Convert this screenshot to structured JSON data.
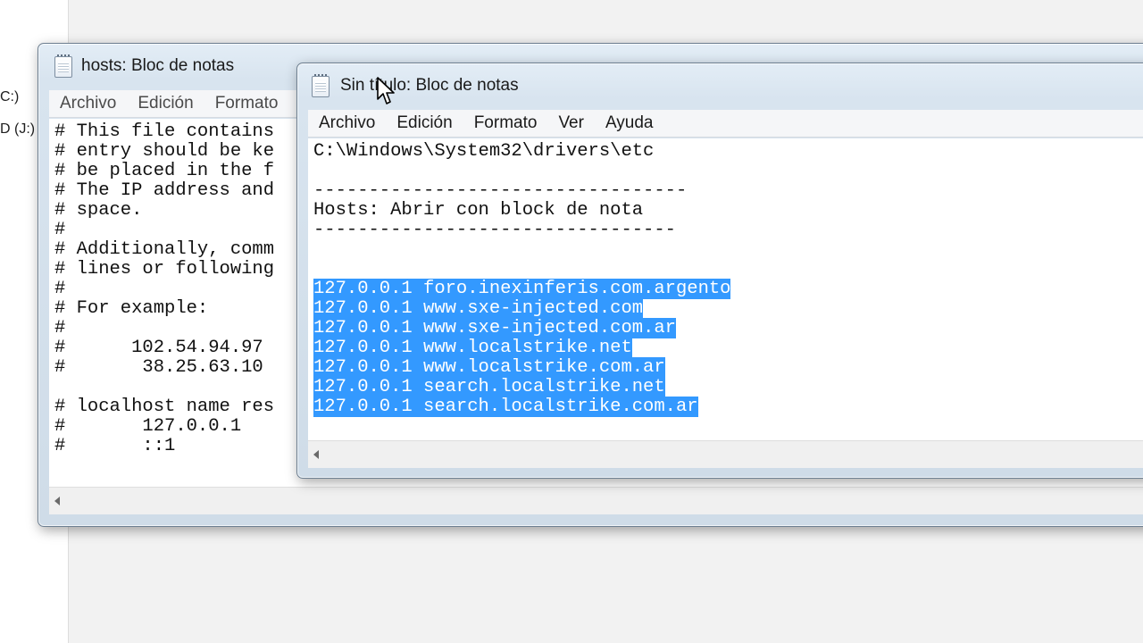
{
  "explorer": {
    "drive1": "C:)",
    "drive2": "D (J:)"
  },
  "back_window": {
    "title": "hosts: Bloc de notas",
    "menu": [
      "Archivo",
      "Edición",
      "Formato"
    ],
    "lines": [
      "# This file contains",
      "# entry should be ke",
      "# be placed in the f",
      "# The IP address and",
      "# space.",
      "#",
      "# Additionally, comm",
      "# lines or following",
      "#",
      "# For example:",
      "#",
      "#      102.54.94.97",
      "#       38.25.63.10",
      "",
      "# localhost name res",
      "#       127.0.0.1",
      "#       ::1"
    ]
  },
  "front_window": {
    "title": "Sin título: Bloc de notas",
    "menu": [
      "Archivo",
      "Edición",
      "Formato",
      "Ver",
      "Ayuda"
    ],
    "lines": [
      "C:\\Windows\\System32\\drivers\\etc",
      "",
      "----------------------------------",
      "Hosts: Abrir con block de nota",
      "---------------------------------",
      "",
      "",
      "127.0.0.1 foro.inexinferis.com.argento",
      "127.0.0.1 www.sxe-injected.com",
      "127.0.0.1 www.sxe-injected.com.ar",
      "127.0.0.1 www.localstrike.net",
      "127.0.0.1 www.localstrike.com.ar",
      "127.0.0.1 search.localstrike.net",
      "127.0.0.1 search.localstrike.com.ar"
    ],
    "selected_from": 7
  },
  "icons": {
    "window_icon": "notepad-icon",
    "cursor": "mouse-pointer-icon",
    "scroll": "scroll-left-arrow-icon"
  },
  "colors": {
    "selection": "#3399ff",
    "frame": "#d8e4ef"
  }
}
